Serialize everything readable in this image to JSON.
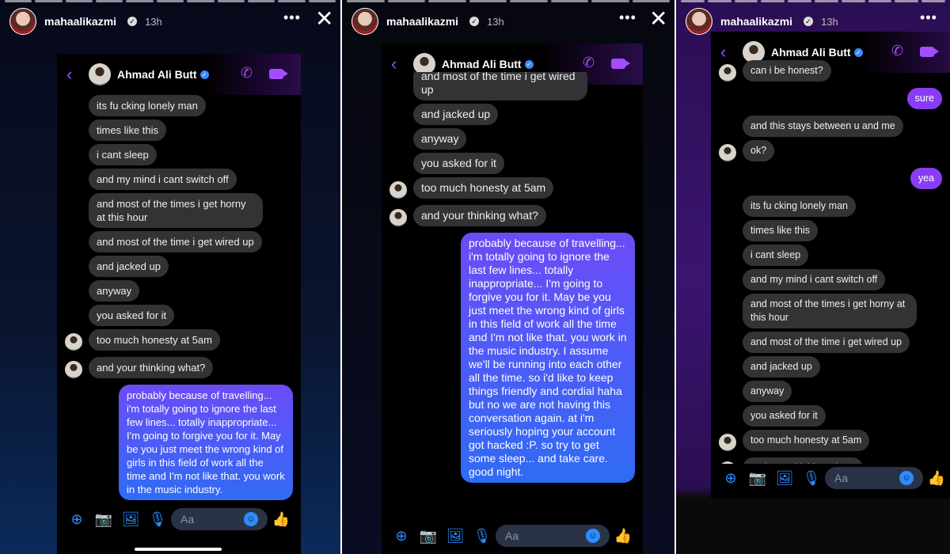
{
  "story": {
    "username": "mahaalikazmi",
    "time": "13h",
    "more": "•••",
    "close": "✕"
  },
  "chat": {
    "contact": "Ahmad Ali Butt",
    "back": "‹",
    "call": "✆",
    "input_placeholder": "Aa"
  },
  "icons": {
    "plus": "plus-icon",
    "camera": "camera-icon",
    "image": "image-icon",
    "mic": "mic-icon",
    "emoji": "emoji-icon",
    "like": "thumbs-up-icon"
  },
  "colors": {
    "sent_bubble": "#8a3cf5",
    "received_bubble": "#333336",
    "accent": "#a44dff",
    "composer_icons": "#2d8cff"
  },
  "panels": [
    {
      "messages": [
        {
          "from": "them",
          "text": "its fu cking lonely man"
        },
        {
          "from": "them",
          "text": "times like this"
        },
        {
          "from": "them",
          "text": "i cant sleep"
        },
        {
          "from": "them",
          "text": "and my mind i cant switch off"
        },
        {
          "from": "them",
          "text": "and most of the times i get horny at this hour"
        },
        {
          "from": "them",
          "text": "and most of the time i get wired up"
        },
        {
          "from": "them",
          "text": "and jacked up"
        },
        {
          "from": "them",
          "text": "anyway"
        },
        {
          "from": "them",
          "text": "you asked for it"
        },
        {
          "from": "them",
          "text": "too much honesty at 5am",
          "avatar": true
        },
        {
          "from": "them",
          "text": "and your thinking what?",
          "avatar": true,
          "gap": true
        },
        {
          "from": "me",
          "text": "probably because of travelling... i'm totally going to ignore the last few lines... totally inappropriate... I'm going to forgive you for it. May be you just meet the wrong kind of girls in this field of work all the time and I'm not like that. you work in the music industry.",
          "long": true,
          "gap": true
        }
      ]
    },
    {
      "messages": [
        {
          "from": "them",
          "text": "and most of the time i get wired up"
        },
        {
          "from": "them",
          "text": "and jacked up"
        },
        {
          "from": "them",
          "text": "anyway"
        },
        {
          "from": "them",
          "text": "you asked for it"
        },
        {
          "from": "them",
          "text": "too much honesty at 5am",
          "avatar": true
        },
        {
          "from": "them",
          "text": "and your thinking what?",
          "avatar": true,
          "gap": true
        },
        {
          "from": "me",
          "text": "probably because of travelling... i'm totally going to ignore the last few lines... totally inappropriate... I'm going to forgive you for it. May be you just meet the wrong kind of girls in this field of work all the time and I'm not like that. you work in the music industry. I assume we'll be running into each other all the time. so i'd like to keep things friendly and cordial haha but no we are not having this conversation again. at i'm seriously hoping your account got hacked :P. so try to get some sleep... and take care. good night.",
          "long": true,
          "gap": true
        }
      ]
    },
    {
      "messages": [
        {
          "from": "them",
          "text": "can i be honest?",
          "avatar": true
        },
        {
          "from": "me",
          "text": "sure",
          "gap": true
        },
        {
          "from": "them",
          "text": "and this stays between u and me",
          "gap": true
        },
        {
          "from": "them",
          "text": "ok?",
          "avatar": true
        },
        {
          "from": "me",
          "text": "yea",
          "gap": true
        },
        {
          "from": "them",
          "text": "its fu cking lonely man",
          "gap": true
        },
        {
          "from": "them",
          "text": "times like this"
        },
        {
          "from": "them",
          "text": "i cant sleep"
        },
        {
          "from": "them",
          "text": "and my mind i cant switch off"
        },
        {
          "from": "them",
          "text": "and most of the times i get horny at this hour"
        },
        {
          "from": "them",
          "text": "and most of the time i get wired up"
        },
        {
          "from": "them",
          "text": "and jacked up"
        },
        {
          "from": "them",
          "text": "anyway"
        },
        {
          "from": "them",
          "text": "you asked for it"
        },
        {
          "from": "them",
          "text": "too much honesty at 5am",
          "avatar": true
        },
        {
          "from": "them",
          "text": "and your thinking what?",
          "avatar": true,
          "gap": true
        }
      ]
    }
  ]
}
